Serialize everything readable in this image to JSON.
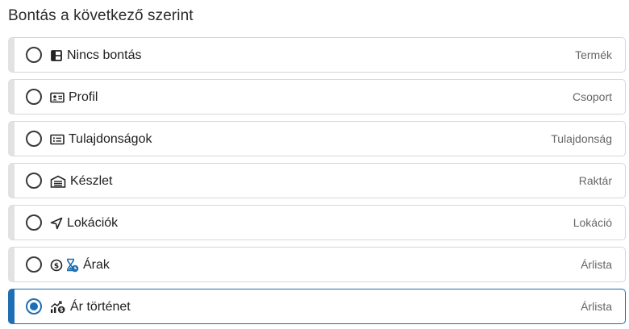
{
  "header": {
    "title": "Bontás a következő szerint"
  },
  "options": [
    {
      "label": "Nincs bontás",
      "right": "Termék",
      "selected": false,
      "icons": [
        "table-layout-icon"
      ]
    },
    {
      "label": "Profil",
      "right": "Csoport",
      "selected": false,
      "icons": [
        "id-card-icon"
      ]
    },
    {
      "label": "Tulajdonságok",
      "right": "Tulajdonság",
      "selected": false,
      "icons": [
        "property-list-icon"
      ]
    },
    {
      "label": "Készlet",
      "right": "Raktár",
      "selected": false,
      "icons": [
        "warehouse-icon"
      ]
    },
    {
      "label": "Lokációk",
      "right": "Lokáció",
      "selected": false,
      "icons": [
        "location-arrow-icon"
      ]
    },
    {
      "label": "Árak",
      "right": "Árlista",
      "selected": false,
      "icons": [
        "price-coin-icon",
        "hourglass-clock-icon"
      ]
    },
    {
      "label": "Ár történet",
      "right": "Árlista",
      "selected": true,
      "icons": [
        "price-trend-icon"
      ]
    }
  ],
  "colors": {
    "accent": "#1f6fb4",
    "border": "#d7d7d7",
    "left_bar": "#e2e2e2",
    "secondary_text": "#666666"
  }
}
